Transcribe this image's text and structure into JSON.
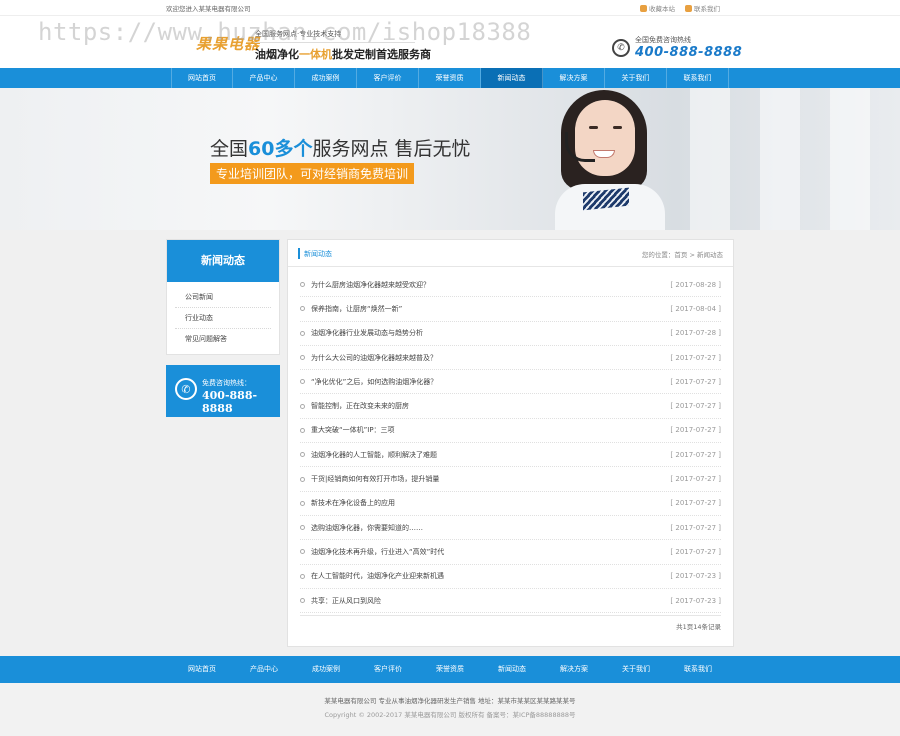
{
  "topbar": {
    "welcome": "欢迎您进入某某电器有限公司",
    "bookmark": "收藏本站",
    "contact": "联系我们"
  },
  "header": {
    "watermark": "https://www.huzhan.com/ishop18388",
    "logo": "果果电器",
    "slogan_line1": "全国服务网点·专业技术支持",
    "slogan_line2_a": "油烟净化",
    "slogan_line2_b": "一体机",
    "slogan_line2_c": "批发定制首选服务商",
    "hotline_label": "全国免费咨询热线",
    "hotline_number": "400-888-8888"
  },
  "nav": {
    "items": [
      "网站首页",
      "产品中心",
      "成功案例",
      "客户评价",
      "荣誉资质",
      "新闻动态",
      "解决方案",
      "关于我们",
      "联系我们"
    ],
    "active_index": 5
  },
  "banner": {
    "headline_a": "全国",
    "headline_b": "60多个",
    "headline_c": "服务网点 售后无忧",
    "tagline": "专业培训团队，可对经销商免费培训"
  },
  "sidebar": {
    "title": "新闻动态",
    "items": [
      "公司新闻",
      "行业动态",
      "常见问题解答"
    ],
    "contact_label": "免费咨询热线：",
    "contact_number": "400-888-8888"
  },
  "main": {
    "title": "新闻动态",
    "breadcrumb": "您的位置：首页 > 新闻动态",
    "news": [
      {
        "title": "为什么厨房油烟净化器越来越受欢迎？",
        "date": "[ 2017-08-28 ]"
      },
      {
        "title": "保养指南，让厨房“焕然一新”",
        "date": "[ 2017-08-04 ]"
      },
      {
        "title": "油烟净化器行业发展动态与趋势分析",
        "date": "[ 2017-07-28 ]"
      },
      {
        "title": "为什么大公司的油烟净化器越来越普及？",
        "date": "[ 2017-07-27 ]"
      },
      {
        "title": "“净化优化”之后，如何选购油烟净化器？",
        "date": "[ 2017-07-27 ]"
      },
      {
        "title": "智能控制，正在改变未来的厨房",
        "date": "[ 2017-07-27 ]"
      },
      {
        "title": "重大突破“一体机”IP：三项",
        "date": "[ 2017-07-27 ]"
      },
      {
        "title": "油烟净化器的人工智能，顺利解决了难题",
        "date": "[ 2017-07-27 ]"
      },
      {
        "title": "干货|经销商如何有效打开市场，提升销量",
        "date": "[ 2017-07-27 ]"
      },
      {
        "title": "新技术在净化设备上的应用",
        "date": "[ 2017-07-27 ]"
      },
      {
        "title": "选购油烟净化器，你需要知道的……",
        "date": "[ 2017-07-27 ]"
      },
      {
        "title": "油烟净化技术再升级，行业进入“高效”时代",
        "date": "[ 2017-07-27 ]"
      },
      {
        "title": "在人工智能时代，油烟净化产业迎来新机遇",
        "date": "[ 2017-07-23 ]"
      },
      {
        "title": "共享：正从风口到风险",
        "date": "[ 2017-07-23 ]"
      }
    ],
    "pager": "共1页14条记录"
  },
  "footer": {
    "nav": [
      "网站首页",
      "产品中心",
      "成功案例",
      "客户评价",
      "荣誉资质",
      "新闻动态",
      "解决方案",
      "关于我们",
      "联系我们"
    ],
    "line1": "某某电器有限公司 专业从事油烟净化器研发生产销售  地址：某某市某某区某某路某某号",
    "line2": "Copyright © 2002-2017 某某电器有限公司 版权所有  备案号：某ICP备88888888号"
  }
}
